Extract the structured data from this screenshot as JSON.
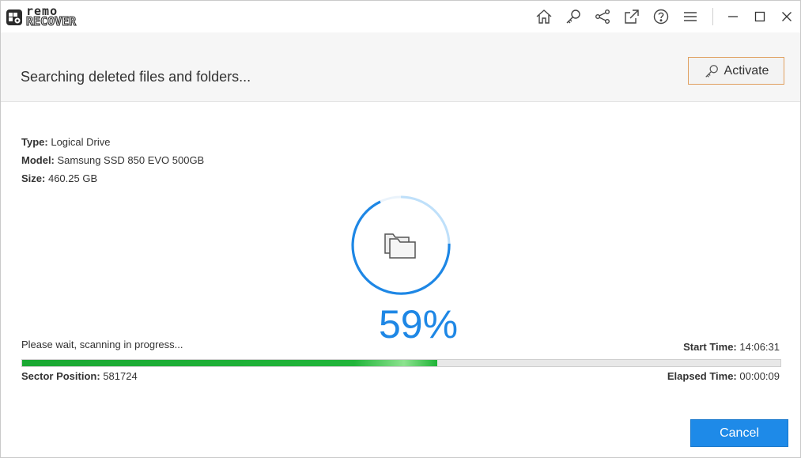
{
  "app": {
    "logo_top": "remo",
    "logo_bottom": "RECOVER"
  },
  "toolbar": {
    "icons": [
      "home-icon",
      "key-icon",
      "share-icon",
      "export-icon",
      "help-icon",
      "menu-icon"
    ]
  },
  "window_controls": [
    "minimize-icon",
    "maximize-icon",
    "close-icon"
  ],
  "header": {
    "title": "Searching deleted files and folders...",
    "activate_label": "Activate"
  },
  "drive": {
    "type_label": "Type:",
    "type_value": "Logical Drive",
    "model_label": "Model:",
    "model_value": "Samsung SSD 850 EVO 500GB",
    "size_label": "Size:",
    "size_value": "460.25 GB"
  },
  "scan": {
    "percent_text": "59%",
    "percent_value": 59,
    "status_text": "Please wait, scanning in progress...",
    "start_time_label": "Start Time:",
    "start_time_value": "14:06:31",
    "sector_label": "Sector Position:",
    "sector_value": "581724",
    "elapsed_label": "Elapsed Time:",
    "elapsed_value": "00:00:09",
    "progress_fraction": 0.547
  },
  "footer": {
    "cancel_label": "Cancel"
  },
  "colors": {
    "accent_blue": "#1e87e5",
    "progress_green": "#21b53a",
    "activate_border": "#e0a060"
  }
}
